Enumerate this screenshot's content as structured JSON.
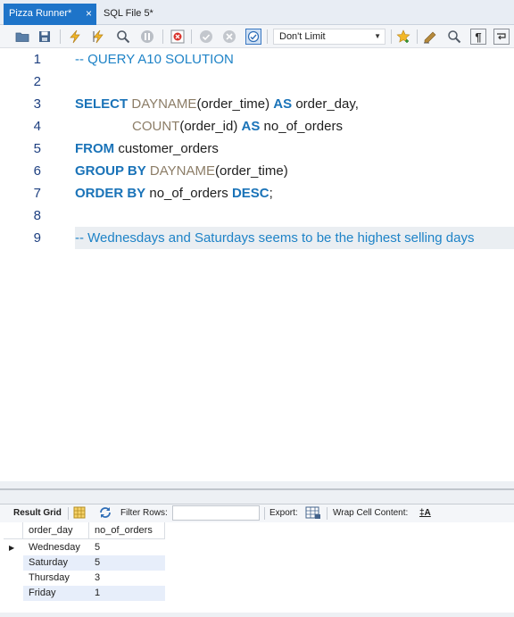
{
  "tabs": [
    {
      "label": "Pizza Runner*",
      "close": "×"
    },
    {
      "label": "SQL File 5*"
    }
  ],
  "toolbar": {
    "limit_value": "Don't Limit"
  },
  "editor": {
    "line_numbers": [
      "1",
      "2",
      "3",
      "4",
      "5",
      "6",
      "7",
      "8",
      "9"
    ],
    "l1": {
      "comment": "-- QUERY A10 SOLUTION"
    },
    "l3": {
      "kw1": "SELECT",
      "fn": "DAYNAME",
      "rest1": "(order_time)",
      "kw2": "AS",
      "rest2": "order_day,"
    },
    "l4": {
      "fn": "COUNT",
      "rest1": "(order_id)",
      "kw": "AS",
      "rest2": "no_of_orders"
    },
    "l5": {
      "kw": "FROM",
      "rest": "customer_orders"
    },
    "l6": {
      "kw": "GROUP BY",
      "fn": "DAYNAME",
      "rest": "(order_time)"
    },
    "l7": {
      "kw1": "ORDER BY",
      "rest": "no_of_orders",
      "kw2": "DESC",
      "end": ";"
    },
    "l9": {
      "comment": "-- Wednesdays and Saturdays seems to be the highest selling days"
    }
  },
  "result_bar": {
    "result_grid": "Result Grid",
    "filter_rows": "Filter Rows:",
    "filter_value": "",
    "export": "Export:",
    "wrap": "Wrap Cell Content:",
    "wrap_icon": "‡A"
  },
  "grid": {
    "columns": [
      "order_day",
      "no_of_orders"
    ],
    "rows": [
      [
        "Wednesday",
        "5"
      ],
      [
        "Saturday",
        "5"
      ],
      [
        "Thursday",
        "3"
      ],
      [
        "Friday",
        "1"
      ]
    ]
  }
}
